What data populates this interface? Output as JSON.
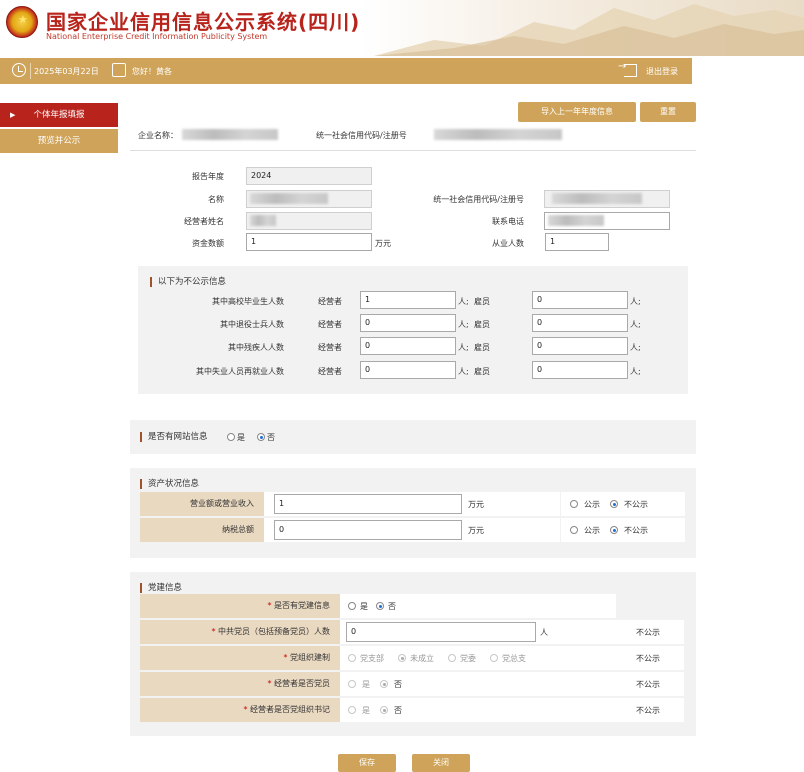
{
  "header": {
    "title": "国家企业信用信息公示系统(四川)",
    "subtitle": "National Enterprise Credit Information Publicity System"
  },
  "infobar": {
    "date": "2025年03月22日",
    "greeting": "您好！黄各",
    "logout": "退出登录"
  },
  "sidebar": {
    "items": [
      {
        "label": "个体年报填报",
        "active": true
      },
      {
        "label": "预览并公示",
        "active": false
      }
    ]
  },
  "toolbar": {
    "import_label": "导入上一年年度信息",
    "reset_label": "重置"
  },
  "company": {
    "name_label": "企业名称：",
    "name_value": "个体工商户",
    "code_label": "统一社会信用代码/注册号",
    "code_value": ""
  },
  "basic": {
    "year_label": "报告年度",
    "year_value": "2024",
    "name_label": "名称",
    "code_label": "统一社会信用代码/注册号",
    "operator_label": "经营者姓名",
    "phone_label": "联系电话",
    "capital_label": "资金数额",
    "capital_value": "1",
    "capital_unit": "万元",
    "staff_label": "从业人数",
    "staff_value": "1"
  },
  "private_section": {
    "title": "以下为不公示信息",
    "rows": [
      {
        "label": "其中高校毕业生人数",
        "op_label": "经营者",
        "op_value": "1",
        "unit1": "人;",
        "emp_label": "雇员",
        "emp_value": "0",
        "unit2": "人;"
      },
      {
        "label": "其中退役士兵人数",
        "op_label": "经营者",
        "op_value": "0",
        "unit1": "人;",
        "emp_label": "雇员",
        "emp_value": "0",
        "unit2": "人;"
      },
      {
        "label": "其中残疾人人数",
        "op_label": "经营者",
        "op_value": "0",
        "unit1": "人;",
        "emp_label": "雇员",
        "emp_value": "0",
        "unit2": "人;"
      },
      {
        "label": "其中失业人员再就业人数",
        "op_label": "经营者",
        "op_value": "0",
        "unit1": "人;",
        "emp_label": "雇员",
        "emp_value": "0",
        "unit2": "人;"
      }
    ]
  },
  "website": {
    "title": "是否有网站信息",
    "yes": "是",
    "no": "否",
    "selected": "no"
  },
  "assets": {
    "title": "资产状况信息",
    "rows": [
      {
        "label": "营业额或营业收入",
        "value": "1",
        "unit": "万元",
        "public": "公示",
        "private": "不公示",
        "selected": "private"
      },
      {
        "label": "纳税总额",
        "value": "0",
        "unit": "万元",
        "public": "公示",
        "private": "不公示",
        "selected": "private"
      }
    ]
  },
  "party": {
    "title": "党建信息",
    "rows": [
      {
        "label": "是否有党建信息",
        "required": "*",
        "options": [
          "是",
          "否"
        ],
        "selected": 1,
        "status": ""
      },
      {
        "label": "中共党员（包括预备党员）人数",
        "required": "*",
        "value": "0",
        "unit": "人",
        "status": "不公示"
      },
      {
        "label": "党组织建制",
        "required": "*",
        "options": [
          "党支部",
          "未成立",
          "党委",
          "党总支"
        ],
        "selected": 1,
        "status": "不公示"
      },
      {
        "label": "经营者是否党员",
        "required": "*",
        "options": [
          "是",
          "否"
        ],
        "selected": 1,
        "status": "不公示"
      },
      {
        "label": "经营者是否党组织书记",
        "required": "*",
        "options": [
          "是",
          "否"
        ],
        "selected": 1,
        "status": "不公示"
      }
    ]
  },
  "footer": {
    "save_label": "保存",
    "close_label": "关闭"
  },
  "colors": {
    "brand_red": "#b8231c",
    "gold": "#cfa45a",
    "label_bg": "#ead9c1",
    "panel_bg": "#f2f2f2"
  }
}
